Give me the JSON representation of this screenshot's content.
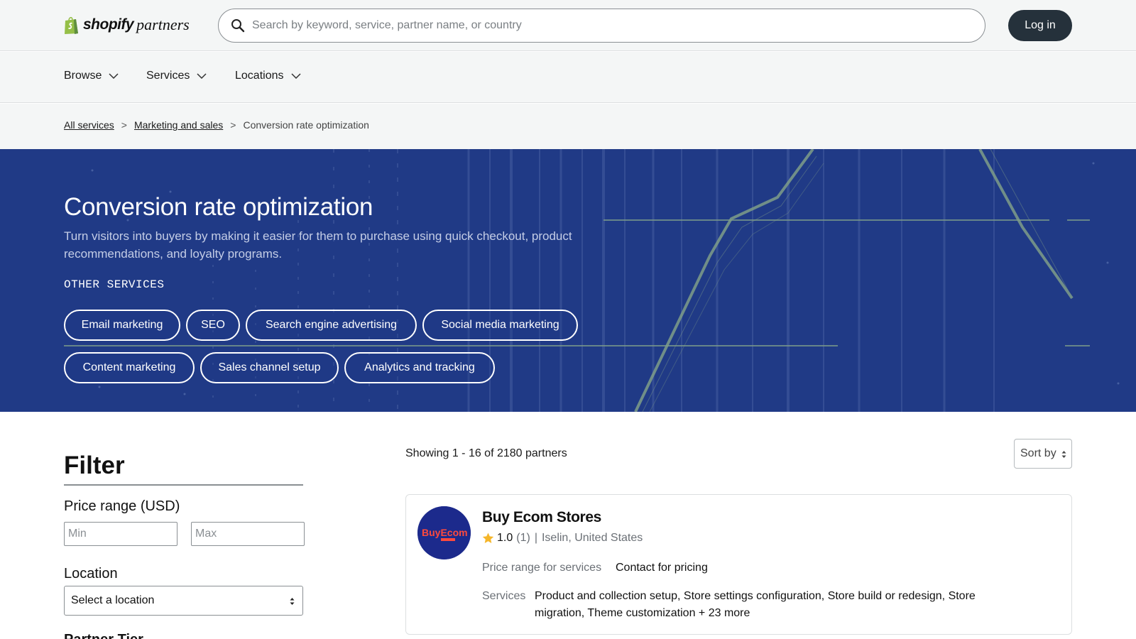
{
  "header": {
    "logo_word": "shopify",
    "logo_suffix": "partners",
    "search_placeholder": "Search by keyword, service, partner name, or country",
    "login_label": "Log in"
  },
  "nav": {
    "items": [
      {
        "label": "Browse"
      },
      {
        "label": "Services"
      },
      {
        "label": "Locations"
      }
    ]
  },
  "breadcrumb": {
    "items": [
      "All services",
      "Marketing and sales"
    ],
    "current": "Conversion rate optimization",
    "separator": ">"
  },
  "hero": {
    "title": "Conversion rate optimization",
    "description": "Turn visitors into buyers by making it easier for them to purchase using quick checkout, product recommendations, and loyalty programs.",
    "other_services_label": "OTHER SERVICES",
    "chips": [
      "Email marketing",
      "SEO",
      "Search engine advertising",
      "Social media marketing",
      "Content marketing",
      "Sales channel setup",
      "Analytics and tracking"
    ]
  },
  "filter": {
    "title": "Filter",
    "price_label": "Price range (USD)",
    "min_placeholder": "Min",
    "max_placeholder": "Max",
    "location_label": "Location",
    "location_value": "Select a location",
    "next_label": "Partner Tier"
  },
  "results": {
    "showing": "Showing 1 - 16 of 2180 partners",
    "sort_label": "Sort by",
    "cards": [
      {
        "name": "Buy Ecom Stores",
        "avatar_text": "BuyEcom",
        "rating": "1.0",
        "rating_count": "(1)",
        "pipe": "|",
        "location": "Iselin, United States",
        "price_label": "Price range for services",
        "price_value": "Contact for pricing",
        "services_label": "Services",
        "services_value": "Product and collection setup, Store settings configuration, Store build or redesign, Store migration, Theme customization + 23 more"
      }
    ]
  },
  "colors": {
    "hero_bg": "#203a86",
    "login_bg": "#25313b",
    "star": "#f5b62a",
    "chart_line": "#7f9e8a"
  }
}
